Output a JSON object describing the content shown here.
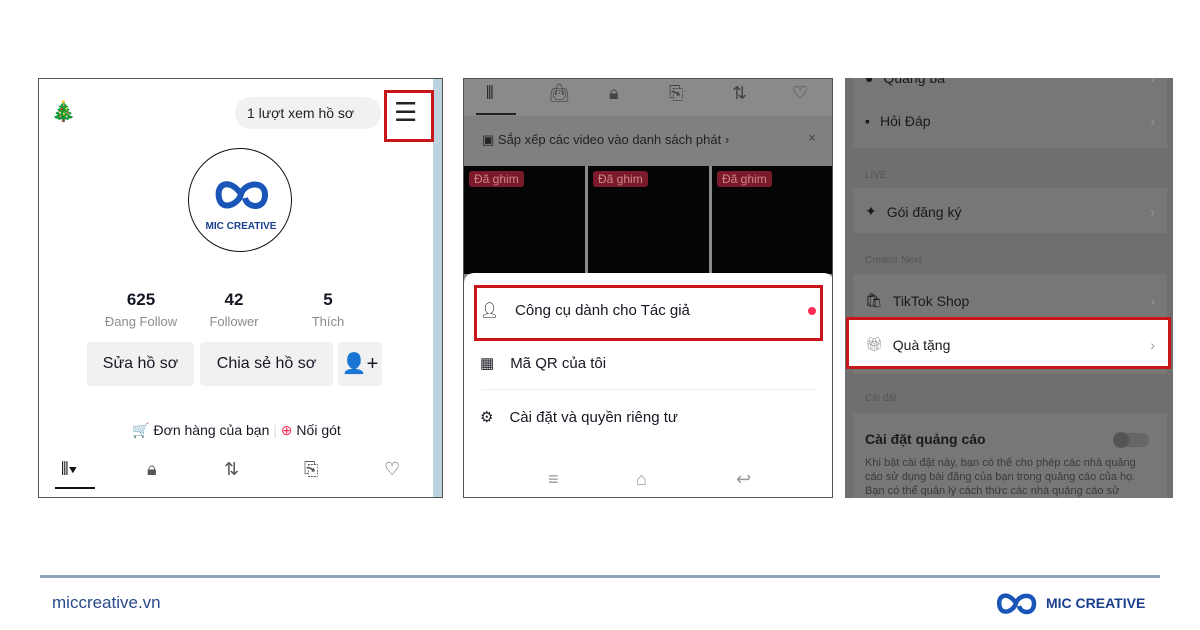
{
  "panel1": {
    "views": "1 lượt xem hồ sơ",
    "avatar_text": "MIC CREATIVE",
    "stats": [
      {
        "n": "625",
        "l": "Đang Follow"
      },
      {
        "n": "42",
        "l": "Follower"
      },
      {
        "n": "5",
        "l": "Thích"
      }
    ],
    "edit": "Sửa hồ sơ",
    "share": "Chia sẻ hồ sơ",
    "orders": "Đơn hàng của bạn",
    "noigot": "Nối gót"
  },
  "panel2": {
    "banner": "Sắp xếp các video vào danh sách phát ›",
    "pinned": "Đã ghim",
    "menu": [
      "Công cụ dành cho Tác giả",
      "Mã QR của tôi",
      "Cài đặt và quyền riêng tư"
    ]
  },
  "panel3": {
    "top": "Quảng bá",
    "qa": "Hỏi Đáp",
    "live": "LIVE",
    "sub": "Gói đăng ký",
    "creator_next": "Creator Next",
    "shop": "TikTok Shop",
    "gifts": "Quà tặng",
    "settings": "Cài đặt",
    "ads": "Cài đặt quảng cáo",
    "ads_desc": "Khi bật cài đặt này, bạn có thể cho phép các nhà quảng cáo sử dụng bài đăng của bạn trong quảng cáo của họ. Bạn có thể quản lý cách thức các nhà quảng cáo sử",
    "ads_toggle_on": false
  },
  "footer": {
    "site": "miccreative.vn",
    "brand": "MIC CREATIVE"
  },
  "colors": {
    "highlight": "#c8161d",
    "brand": "#1a4fa0",
    "accent": "#fe2c55"
  }
}
